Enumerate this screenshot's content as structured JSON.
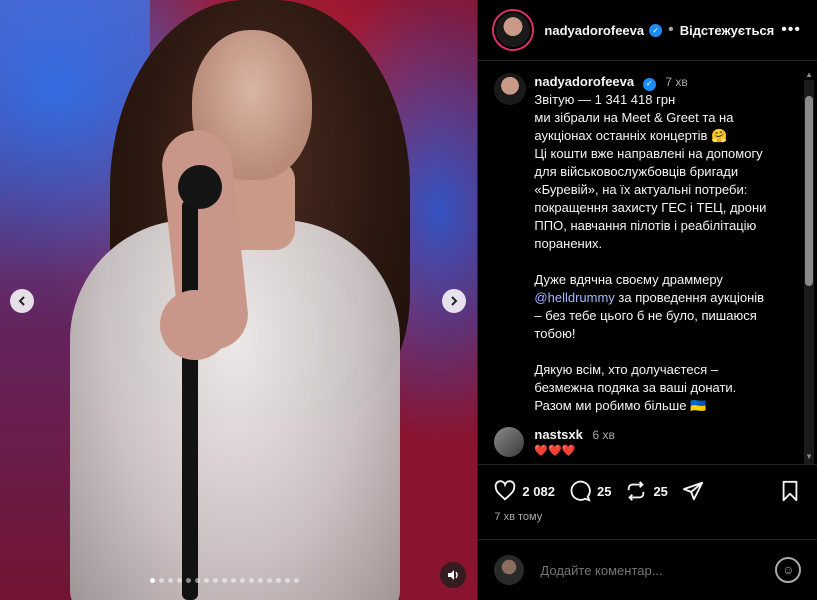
{
  "post": {
    "username": "nadyadorofeeva",
    "follow_status": "Відстежується",
    "more_label": "•••",
    "caption_time": "7 хв",
    "caption_lines": [
      "Звітую — 1 341 418 грн",
      "ми зібрали на Meet & Greet та на",
      "аукціонах останніх концертів 🤗",
      "Ці кошти вже направлені на допомогу",
      "для військовослужбовців бригади",
      "«Буревій», на їх актуальні потреби:",
      "покращення захисту ГЕС і ТЕЦ, дрони",
      "ППО, навчання пілотів і реабілітацію",
      "поранених.",
      "",
      "Дуже вдячна своєму драммеру"
    ],
    "mention": "@helldrummy",
    "caption_after_mention": " за проведення аукціонів\n– без тебе цього б не було, пишаюся\nтобою!\n\nДякую всім, хто долучаєтеся –\nбезмежна подяка за ваші донати.\nРазом ми робимо більше 🇺🇦",
    "likes": "2 082",
    "comments_count": "25",
    "reposts": "25",
    "posted_ago": "7 хв тому"
  },
  "comments": [
    {
      "username": "nastsxk",
      "time": "6 хв",
      "text": "❤️❤️❤️"
    }
  ],
  "composer": {
    "placeholder": "Додайте коментар..."
  },
  "carousel": {
    "total_slides": 17,
    "active_slide": 1
  },
  "colors": {
    "accent": "#1d8cf8",
    "mention": "#a5b8ff",
    "background": "#000000"
  }
}
